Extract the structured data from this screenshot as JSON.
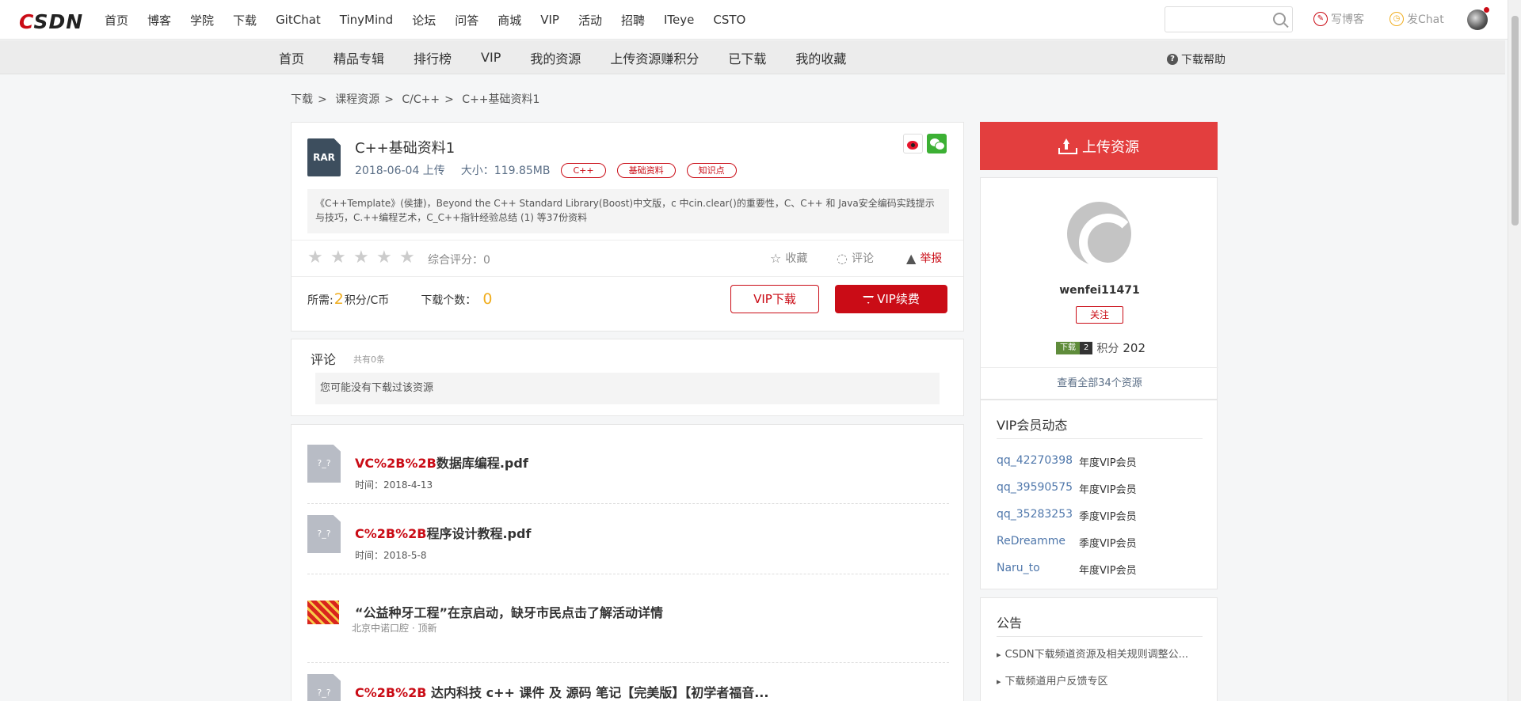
{
  "logo": "CSDN",
  "topnav": [
    "首页",
    "博客",
    "学院",
    "下载",
    "GitChat",
    "TinyMind",
    "论坛",
    "问答",
    "商城",
    "VIP",
    "活动",
    "招聘",
    "ITeye",
    "CSTO"
  ],
  "search": {
    "placeholder": ""
  },
  "tools": {
    "write_blog": "写博客",
    "post_chat": "发Chat"
  },
  "subnav": [
    "首页",
    "精品专辑",
    "排行榜",
    "VIP",
    "我的资源",
    "上传资源赚积分",
    "已下载",
    "我的收藏"
  ],
  "help": "下载帮助",
  "breadcrumb": [
    "下载",
    "课程资源",
    "C/C++",
    "C++基础资料1"
  ],
  "resource": {
    "type_icon": "RAR",
    "title": "C++基础资料1",
    "date": "2018-06-04 上传",
    "size": "大小：119.85MB",
    "tags": [
      "C++",
      "基础资料",
      "知识点"
    ],
    "description": "《C++Template》(侯捷)，Beyond the C++ Standard Library(Boost)中文版，c 中cin.clear()的重要性，C、C++ 和 Java安全编码实践提示与技巧，C.++编程艺术，C_C++指针经验总结 (1) 等37份资料",
    "score": "综合评分：0",
    "actions": {
      "favorite": "收藏",
      "comment": "评论",
      "report": "举报"
    },
    "need_label": "所需:",
    "need_num": "2",
    "need_unit": "积分/C币",
    "download_label": "下载个数：",
    "download_count": "0",
    "vip_download": "VIP下载",
    "vip_renew": "VIP续费"
  },
  "comments": {
    "title": "评论",
    "count": "共有0条",
    "placeholder": "您可能没有下载过该资源"
  },
  "related": [
    {
      "icon": "?_?",
      "hl": "VC%2B%2B",
      "rest": "数据库编程.pdf",
      "time": "时间：2018-4-13"
    },
    {
      "icon": "?_?",
      "hl": "C%2B%2B",
      "rest": "程序设计教程.pdf",
      "time": "时间：2018-5-8"
    },
    {
      "icon": "ad",
      "hl": "",
      "rest": "“公益种牙工程”在京启动，缺牙市民点击了解活动详情",
      "sub": "北京中诺口腔 · 顶新"
    },
    {
      "icon": "?_?",
      "hl": "C%2B%2B",
      "rest": " 达内科技 c++ 课件 及 源码 笔记【完美版】【初学者福音..."
    }
  ],
  "sidebar": {
    "upload": "上传资源",
    "user": {
      "name": "wenfei11471",
      "follow": "关注",
      "badge_a": "下载",
      "badge_b": "2",
      "points_label": "积分",
      "points": "202",
      "view_all": "查看全部34个资源"
    },
    "vip_title": "VIP会员动态",
    "vip_members": [
      {
        "user": "qq_42270398",
        "type": "年度VIP会员"
      },
      {
        "user": "qq_39590575",
        "type": "年度VIP会员"
      },
      {
        "user": "qq_35283253",
        "type": "季度VIP会员"
      },
      {
        "user": "ReDreamme",
        "type": "季度VIP会员"
      },
      {
        "user": "Naru_to",
        "type": "年度VIP会员"
      }
    ],
    "notice_title": "公告",
    "notices": [
      "CSDN下载频道资源及相关规则调整公...",
      "下载频道用户反馈专区"
    ]
  },
  "colors": {
    "brand_red": "#ca0c16",
    "upload_red": "#e33e3e",
    "link_blue": "#4f77ab",
    "gold": "#f0ad1e"
  }
}
